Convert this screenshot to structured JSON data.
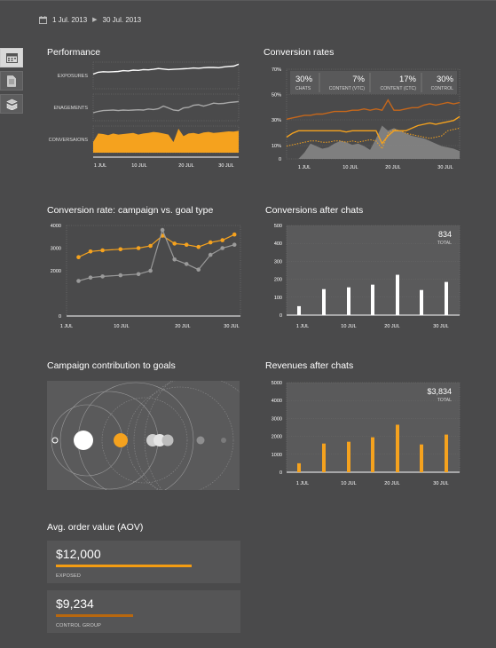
{
  "date_range": {
    "start": "1 Jul. 2013",
    "end": "30 Jul. 2013"
  },
  "nav": [
    {
      "icon": "calendar-icon",
      "active": true
    },
    {
      "icon": "document-icon",
      "active": false
    },
    {
      "icon": "stack-icon",
      "active": false
    }
  ],
  "performance": {
    "title": "Performance",
    "rows": [
      "EXPOSURES",
      "ENAGEMENTS",
      "CONVERSAIONS"
    ],
    "x_ticks": [
      "1 JUL",
      "10 JUL",
      "20 JUL",
      "30 JUL"
    ],
    "chart_data": {
      "type": "line",
      "x_ticks": [
        "1 JUL",
        "10 JUL",
        "20 JUL",
        "30 JUL"
      ],
      "series": [
        {
          "name": "EXPOSURES",
          "values": [
            55,
            62,
            64,
            63,
            64,
            65,
            68,
            67,
            70,
            69,
            72,
            71,
            73,
            76,
            74,
            72,
            73,
            74,
            75,
            76,
            78,
            77,
            79,
            80,
            80,
            79,
            82,
            84,
            85,
            92
          ]
        },
        {
          "name": "ENAGEMENTS",
          "values": [
            30,
            35,
            38,
            39,
            40,
            38,
            40,
            39,
            40,
            41,
            40,
            44,
            42,
            45,
            55,
            48,
            40,
            38,
            48,
            50,
            58,
            60,
            55,
            60,
            66,
            64,
            65,
            68,
            70,
            72
          ]
        },
        {
          "name": "CONVERSAIONS",
          "values": [
            40,
            72,
            70,
            66,
            72,
            68,
            70,
            72,
            74,
            68,
            72,
            74,
            78,
            76,
            72,
            68,
            40,
            90,
            62,
            72,
            74,
            70,
            76,
            78,
            74,
            76,
            78,
            80,
            79,
            82
          ]
        }
      ]
    }
  },
  "conversion_rates": {
    "title": "Conversion rates",
    "stats": [
      {
        "value": "30%",
        "label": "CHATS"
      },
      {
        "value": "7%",
        "label": "CONTENT (VTC)"
      },
      {
        "value": "17%",
        "label": "CONTENT (CTC)"
      },
      {
        "value": "30%",
        "label": "CONTROL"
      }
    ],
    "y_ticks": [
      "70%",
      "50%",
      "30%",
      "10%",
      "0"
    ],
    "x_ticks": [
      "1 JUL",
      "10 JUL",
      "20 JUL",
      "30 JUL"
    ],
    "chart_data": {
      "type": "line",
      "y_range": [
        0,
        70
      ],
      "x_ticks": [
        "1 JUL",
        "10 JUL",
        "20 JUL",
        "30 JUL"
      ],
      "series": [
        {
          "name": "CHATS",
          "values": [
            31,
            32,
            33,
            34,
            34,
            35,
            35,
            36,
            37,
            37,
            37,
            38,
            38,
            39,
            38,
            39,
            38,
            46,
            38,
            38,
            39,
            40,
            40,
            42,
            43,
            42,
            43,
            44,
            43,
            44
          ]
        },
        {
          "name": "CONTENT (VTC)",
          "values": [
            17,
            20,
            22,
            22,
            22,
            22,
            22,
            22,
            22,
            22,
            21,
            22,
            22,
            22,
            22,
            22,
            12,
            18,
            22,
            22,
            22,
            24,
            26,
            27,
            28,
            27,
            28,
            29,
            30,
            33
          ]
        },
        {
          "name": "CONTENT (CTC)",
          "values": [
            10,
            11,
            12,
            13,
            14,
            14,
            13,
            13,
            14,
            14,
            13,
            14,
            13,
            14,
            15,
            14,
            8,
            20,
            23,
            22,
            20,
            19,
            18,
            17,
            16,
            17,
            18,
            22,
            23,
            24
          ]
        },
        {
          "name": "CONTROL",
          "values": [
            0,
            0,
            0,
            5,
            12,
            10,
            8,
            9,
            12,
            14,
            13,
            11,
            12,
            10,
            7,
            16,
            26,
            22,
            24,
            22,
            20,
            18,
            17,
            16,
            14,
            12,
            10,
            9,
            8,
            6
          ]
        }
      ]
    }
  },
  "campaign_vs_goal": {
    "title": "Conversion rate: campaign vs. goal type",
    "y_ticks": [
      "4000",
      "3000",
      "2000",
      "0"
    ],
    "x_ticks": [
      "1 JUL",
      "10 JUL",
      "20 JUL",
      "30 JUL"
    ],
    "chart_data": {
      "type": "line",
      "y_range": [
        0,
        4000
      ],
      "x_ticks": [
        "1 JUL",
        "10 JUL",
        "20 JUL",
        "30 JUL"
      ],
      "series": [
        {
          "name": "",
          "x": [
            3,
            5,
            7,
            10,
            13,
            15,
            17,
            19,
            21,
            23,
            25,
            27,
            29
          ],
          "values": [
            2600,
            2850,
            2900,
            2950,
            3000,
            3100,
            3550,
            3200,
            3150,
            3050,
            3250,
            3350,
            3600
          ]
        },
        {
          "name": "",
          "x": [
            3,
            5,
            7,
            10,
            13,
            15,
            17,
            19,
            21,
            23,
            25,
            27,
            29
          ],
          "values": [
            1550,
            1700,
            1750,
            1800,
            1850,
            2000,
            3800,
            2500,
            2300,
            2050,
            2700,
            3000,
            3150
          ]
        }
      ]
    }
  },
  "conversions_after_chats": {
    "title": "Conversions after chats",
    "total_value": "834",
    "total_label": "TOTAL",
    "y_ticks": [
      "500",
      "400",
      "300",
      "200",
      "100",
      "0"
    ],
    "x_ticks": [
      "1 JUL",
      "10 JUL",
      "20 JUL",
      "30 JUL"
    ],
    "chart_data": {
      "type": "bar",
      "y_range": [
        0,
        500
      ],
      "values": [
        50,
        145,
        155,
        170,
        225,
        140,
        185
      ]
    }
  },
  "campaign_contribution": {
    "title": "Campaign contribution to goals"
  },
  "revenues_after_chats": {
    "title": "Revenues after chats",
    "total_value": "$3,834",
    "total_label": "TOTAL",
    "y_ticks": [
      "5000",
      "4000",
      "3000",
      "2000",
      "1000",
      "0"
    ],
    "x_ticks": [
      "1 JUL",
      "10 JUL",
      "20 JUL",
      "30 JUL"
    ],
    "chart_data": {
      "type": "bar",
      "y_range": [
        0,
        5000
      ],
      "values": [
        500,
        1600,
        1700,
        1950,
        2650,
        1550,
        2100
      ]
    }
  },
  "aov": {
    "title": "Avg. order value (AOV)",
    "items": [
      {
        "value": "$12,000",
        "label": "EXPOSED",
        "bar_fraction": 0.7,
        "color": "#f39c12"
      },
      {
        "value": "$9,234",
        "label": "CONTROL GROUP",
        "bar_fraction": 0.4,
        "color": "#b8670e"
      }
    ]
  },
  "colors": {
    "accent": "#f5a21e",
    "dark_accent": "#c6671b",
    "bg": "#4a4a4b",
    "panel": "#5a5a5b"
  }
}
